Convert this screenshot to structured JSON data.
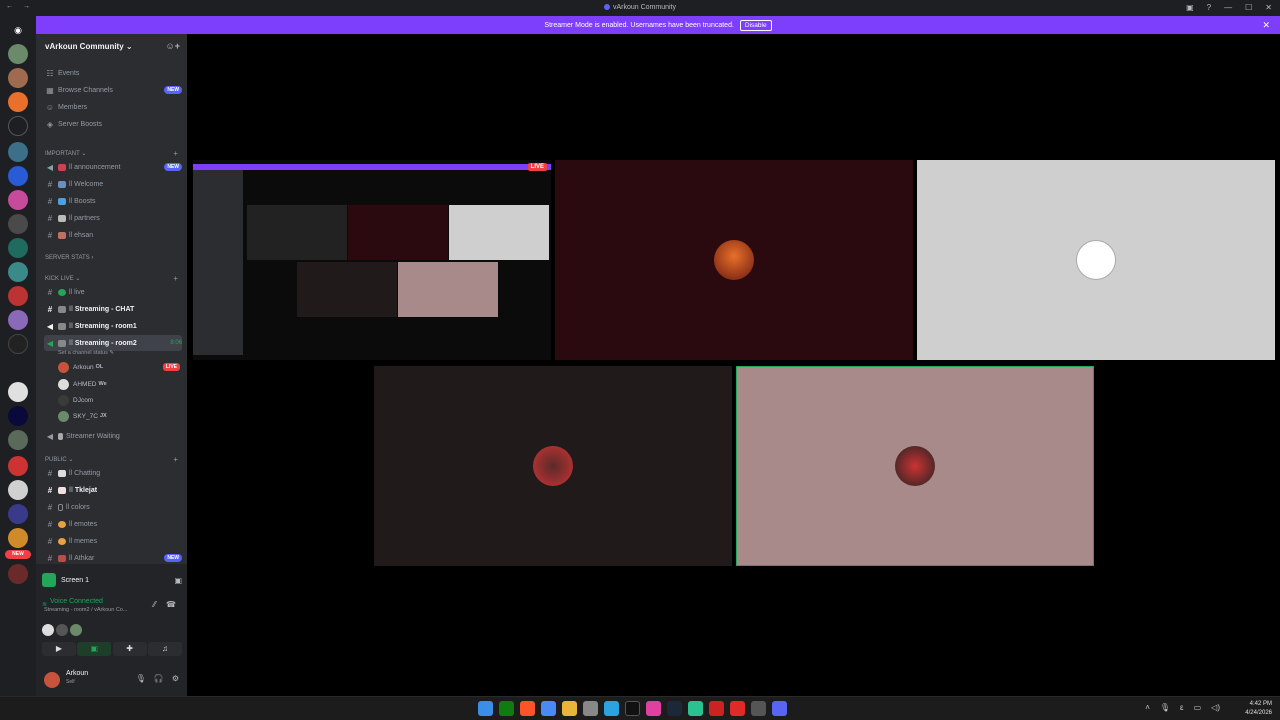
{
  "window": {
    "title": "vArkoun Community",
    "controls": [
      "—",
      "☐",
      "✕"
    ]
  },
  "streamer_banner": {
    "text": "Streamer Mode is enabled. Usernames have been truncated.",
    "button": "Disable"
  },
  "guild_bar": {
    "new_label": "NEW"
  },
  "server": {
    "name": "vArkoun Community ⌄"
  },
  "top_items": [
    {
      "icon": "calendar-icon",
      "glyph": "☷",
      "label": "Events"
    },
    {
      "icon": "browse-channels-icon",
      "glyph": "▦",
      "label": "Browse Channels",
      "badge": "NEW"
    },
    {
      "icon": "members-icon",
      "glyph": "☺",
      "label": "Members"
    },
    {
      "icon": "boost-icon",
      "glyph": "◈",
      "label": "Server Boosts"
    }
  ],
  "categories": {
    "important": "IMPORTANT",
    "server_stats": "SERVER STATS",
    "kick_live": "KICK LIVE",
    "public": "PUBLIC"
  },
  "important_channels": [
    {
      "icon": "announcement-icon",
      "glyph": "📢",
      "label": "announcement",
      "badge": "NEW"
    },
    {
      "icon": "hash-icon",
      "glyph": "#",
      "label": "Welcome"
    },
    {
      "icon": "hash-icon",
      "glyph": "#",
      "label": "Boosts"
    },
    {
      "icon": "hash-icon",
      "glyph": "#",
      "label": "partners"
    },
    {
      "icon": "hash-icon",
      "glyph": "#",
      "label": "ehsan"
    }
  ],
  "kick_channels": [
    {
      "label": "live"
    },
    {
      "label": "Streaming - CHAT"
    },
    {
      "label": "Streaming - room1"
    },
    {
      "label": "Streaming - room2",
      "time": "8:06"
    }
  ],
  "channel_status": "Set a channel status ✎",
  "voice_users": [
    {
      "name": "Arkoun",
      "tag": "OL",
      "live": "LIVE"
    },
    {
      "name": "AHMED",
      "tag": "We"
    },
    {
      "name": "DJcom"
    },
    {
      "name": "SKY_7C",
      "tag": "JX"
    }
  ],
  "waiting_channel": "Streamer Waiting",
  "public_channels": [
    {
      "label": "Chatting"
    },
    {
      "label": "Tklejat"
    },
    {
      "label": "colors"
    },
    {
      "label": "emotes"
    },
    {
      "label": "memes"
    },
    {
      "label": "Athkar",
      "badge": "NEW"
    }
  ],
  "screen_share": {
    "label": "Screen 1"
  },
  "voice": {
    "status": "Voice Connected",
    "location": "Streaming - room2 / vArkoun Co..."
  },
  "user": {
    "name": "Arkoun",
    "status": "Self"
  },
  "tiles": {
    "live_label": "LIVE"
  },
  "taskbar": {
    "time": "4:42 PM",
    "date": "4/24/2026"
  },
  "colors": {
    "accent": "#5865f2",
    "streamer": "#7e3ffd",
    "online": "#23a55a",
    "danger": "#f23f43"
  }
}
